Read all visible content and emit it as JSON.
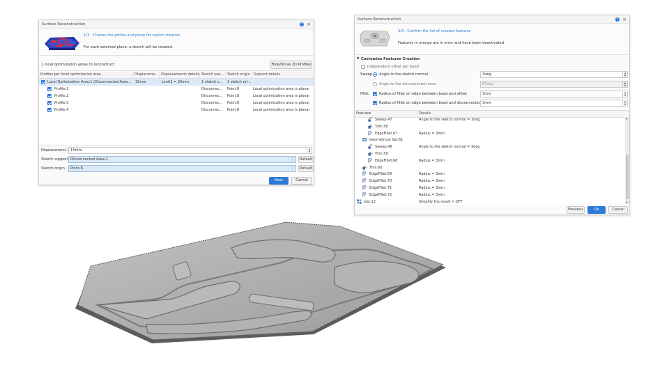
{
  "left_dialog": {
    "title": "Surface Reconstruction",
    "step": "1/3 : Choose the profile and plane for sketch creation.",
    "description": "For each selected plane, a sketch will be created.",
    "areas_count": "1 local optimization areas to reconstruct",
    "hide_show_button": "Hide/Show 2D Profiles",
    "columns": [
      "Profiles per local optimization area",
      "Displaceme...",
      "Displacements details",
      "Sketch sup...",
      "Sketch origin",
      "Support details"
    ],
    "rows": [
      {
        "name": "Local Optimization Area.1 (Disconnected Area...",
        "displacement": "15mm",
        "details": "Limit2 = 20mm",
        "support": "1 sketch s...",
        "origin": "1 sketch ori...",
        "support_details": ""
      },
      {
        "name": "Profile.1",
        "displacement": "",
        "details": "",
        "support": "Disconnec...",
        "origin": "Point.8",
        "support_details": "Local optimization area is planar"
      },
      {
        "name": "Profile.2",
        "displacement": "",
        "details": "",
        "support": "Disconnec...",
        "origin": "Point.8",
        "support_details": "Local optimization area is planar"
      },
      {
        "name": "Profile.3",
        "displacement": "",
        "details": "",
        "support": "Disconnec...",
        "origin": "Point.8",
        "support_details": "Local optimization area is planar"
      },
      {
        "name": "Profile.4",
        "displacement": "",
        "details": "",
        "support": "Disconnec...",
        "origin": "Point.8",
        "support_details": "Local optimization area is planar"
      }
    ],
    "displacement_label": "Displacement 2",
    "displacement_value": "15mm",
    "sketch_support_label": "Sketch support",
    "sketch_support_value": "Disconnected Area.1",
    "sketch_origin_label": "Sketch origin",
    "sketch_origin_value": "Point.8",
    "default_label": "Default",
    "next_label": "Next",
    "cancel_label": "Cancel"
  },
  "right_dialog": {
    "title": "Surface Reconstruction",
    "step": "3/3 : Confirm the list of created features",
    "description": "Features in orange are in error and have been deactivated.",
    "section_title": "Customize Features Creation",
    "independent_offset": "Independent offset per bead",
    "sweep_label": "Sweep",
    "sweep_opt1": "Angle to the sketch normal",
    "sweep_opt1_value": "3deg",
    "sweep_opt2": "Angle to the disconnected area",
    "sweep_opt2_value": "87deg",
    "fillet_label": "Fillet",
    "fillet_opt1": "Radius of fillet on edge between bead and offset",
    "fillet_opt1_value": "3mm",
    "fillet_opt2": "Radius of fillet on edge between bead and disconnected area",
    "fillet_opt2_value": "3mm",
    "feat_col": "Features",
    "details_col": "Details",
    "features": [
      {
        "name": "Sweep.47",
        "details": "Angle to the sketch normal = 3deg",
        "indent": 2,
        "icon": "sweep-icon"
      },
      {
        "name": "Trim.58",
        "details": "",
        "indent": 2,
        "icon": "trim-icon"
      },
      {
        "name": "EdgeFillet.67",
        "details": "Radius = 3mm",
        "indent": 2,
        "icon": "edge-fillet-icon"
      },
      {
        "name": "Geometrical Set.61",
        "details": "",
        "indent": 1,
        "icon": "geometrical-set-icon"
      },
      {
        "name": "Sweep.48",
        "details": "Angle to the sketch normal = 3deg",
        "indent": 2,
        "icon": "sweep-icon"
      },
      {
        "name": "Trim.59",
        "details": "",
        "indent": 2,
        "icon": "trim-icon"
      },
      {
        "name": "EdgeFillet.68",
        "details": "Radius = 3mm",
        "indent": 2,
        "icon": "edge-fillet-icon"
      },
      {
        "name": "Trim.60",
        "details": "",
        "indent": 1,
        "icon": "trim-icon"
      },
      {
        "name": "EdgeFillet.69",
        "details": "Radius = 3mm",
        "indent": 1,
        "icon": "edge-fillet-icon"
      },
      {
        "name": "EdgeFillet.70",
        "details": "Radius = 3mm",
        "indent": 1,
        "icon": "edge-fillet-icon"
      },
      {
        "name": "EdgeFillet.71",
        "details": "Radius = 3mm",
        "indent": 1,
        "icon": "edge-fillet-icon"
      },
      {
        "name": "EdgeFillet.72",
        "details": "Radius = 3mm",
        "indent": 1,
        "icon": "edge-fillet-icon"
      },
      {
        "name": "Join.12",
        "details": "Simplify the result = OFF",
        "indent": 0,
        "icon": "join-icon"
      }
    ],
    "previous_label": "Previous",
    "ok_label": "Ok",
    "cancel_label": "Cancel"
  },
  "colors": {
    "accent": "#2f7ad6",
    "selection": "#dce9f7",
    "panel_surface": "#a9a9a9"
  }
}
